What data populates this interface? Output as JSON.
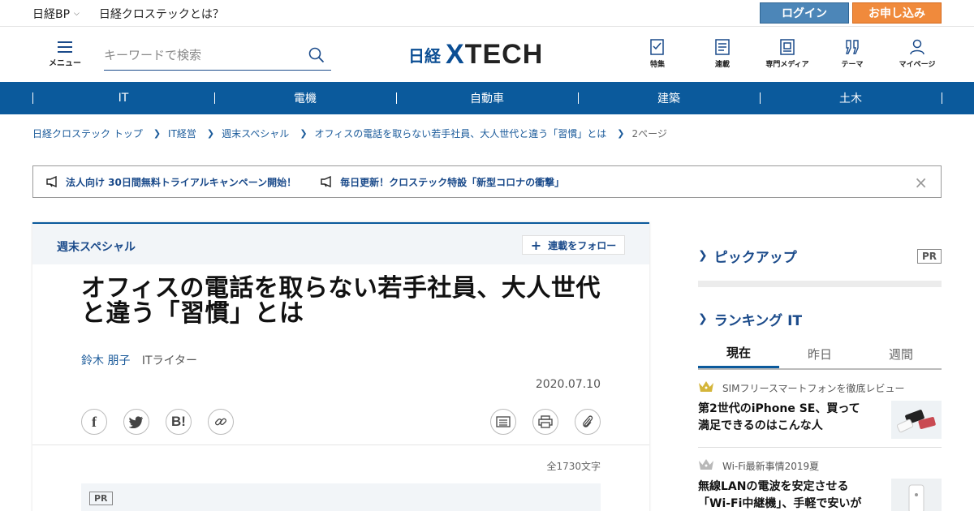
{
  "topbar": {
    "brand": "日経BP",
    "about": "日経クロステックとは？",
    "login": "ログイン",
    "apply": "お申し込み"
  },
  "header": {
    "menu_label": "メニュー",
    "search_placeholder": "キーワードで検索",
    "logo_prefix": "日経",
    "logo_x": "X",
    "logo_text": "TECH",
    "nav": [
      {
        "label": "特集",
        "icon": "feature-icon"
      },
      {
        "label": "連載",
        "icon": "series-icon"
      },
      {
        "label": "専門メディア",
        "icon": "media-icon"
      },
      {
        "label": "テーマ",
        "icon": "theme-icon"
      },
      {
        "label": "マイページ",
        "icon": "user-icon"
      }
    ]
  },
  "categories": [
    "IT",
    "電機",
    "自動車",
    "建築",
    "土木"
  ],
  "breadcrumb": {
    "items": [
      "日経クロステック トップ",
      "IT経営",
      "週末スペシャル",
      "オフィスの電話を取らない若手社員、大人世代と違う「習慣」とは"
    ],
    "current": "2ページ"
  },
  "notice": {
    "items": [
      "法人向け 30日間無料トライアルキャンペーン開始！",
      "毎日更新！クロステック特設「新型コロナの衝撃」"
    ],
    "close": "×"
  },
  "article": {
    "series": "週末スペシャル",
    "follow": "連載をフォロー",
    "title": "オフィスの電話を取らない若手社員、大人世代と違う「習慣」とは",
    "author": "鈴木 朋子",
    "author_role": "ITライター",
    "date": "2020.07.10",
    "char_count": "全1730文字",
    "pr": "PR",
    "share": [
      "facebook-icon",
      "twitter-icon",
      "hatena-icon",
      "link-icon"
    ],
    "tools": [
      "comment-icon",
      "print-icon",
      "clip-icon"
    ]
  },
  "sidebar": {
    "pickup_title": "ピックアップ",
    "pr": "PR",
    "ranking_title": "ランキング IT",
    "tabs": [
      "現在",
      "昨日",
      "週間"
    ],
    "active_tab": 0,
    "ranking": [
      {
        "sub": "SIMフリースマートフォンを徹底レビュー",
        "headline": "第2世代のiPhone SE、買って満足できるのはこんな人"
      },
      {
        "sub": "Wi-Fi最新事情2019夏",
        "headline": "無線LANの電波を安定させる「Wi-Fi中継機」、手軽で安いが"
      }
    ]
  },
  "colors": {
    "primary": "#0b5a9c",
    "login": "#4c86b8",
    "apply": "#f08a3c",
    "link": "#1a5a9a"
  }
}
